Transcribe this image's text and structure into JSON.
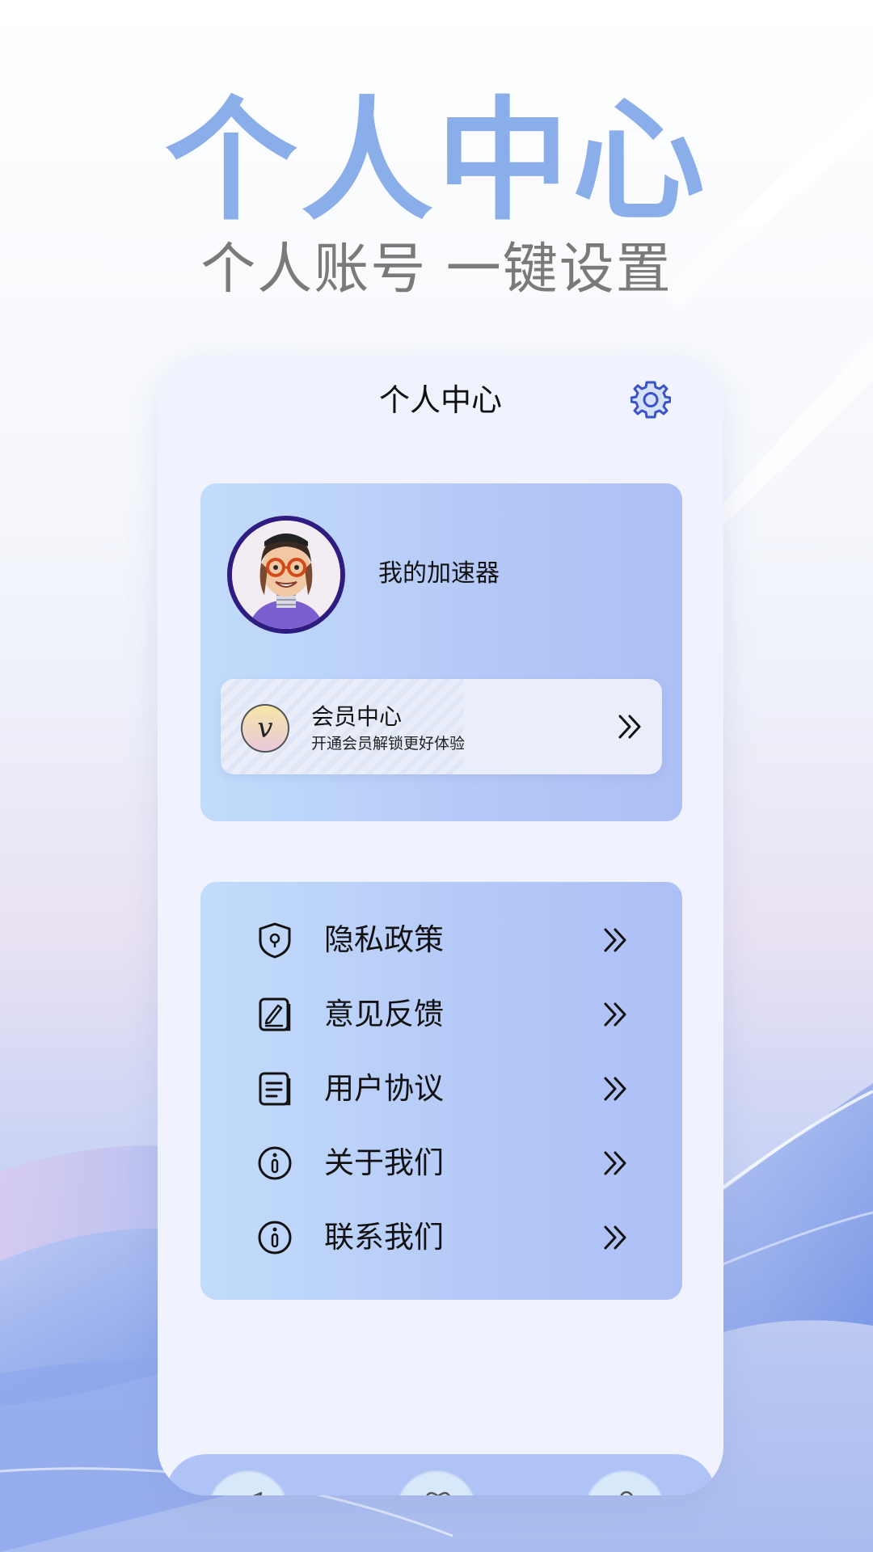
{
  "promo": {
    "headline": "个人中心",
    "subheadline": "个人账号 一键设置"
  },
  "screen": {
    "title": "个人中心",
    "settings_icon": "gear-icon",
    "profile": {
      "username": "我的加速器",
      "avatar": "cartoon-avatar"
    },
    "vip": {
      "badge": "v",
      "title": "会员中心",
      "subtitle": "开通会员解锁更好体验"
    },
    "menu": [
      {
        "label": "隐私政策",
        "icon": "shield-lock-icon"
      },
      {
        "label": "意见反馈",
        "icon": "edit-note-icon"
      },
      {
        "label": "用户协议",
        "icon": "document-icon"
      },
      {
        "label": "关于我们",
        "icon": "info-icon"
      },
      {
        "label": "联系我们",
        "icon": "info-icon"
      }
    ],
    "tabbar": [
      "send-icon",
      "heart-icon",
      "user-icon"
    ]
  },
  "colors": {
    "headline": "#8aaeea",
    "subheadline": "#7a7a7a",
    "phone_bg": "#f0f2fd",
    "card_gradient_start": "#c2dcfb",
    "card_gradient_end": "#adbff5",
    "avatar_ring": "#2e1c80",
    "gear": "#3a52c8"
  }
}
